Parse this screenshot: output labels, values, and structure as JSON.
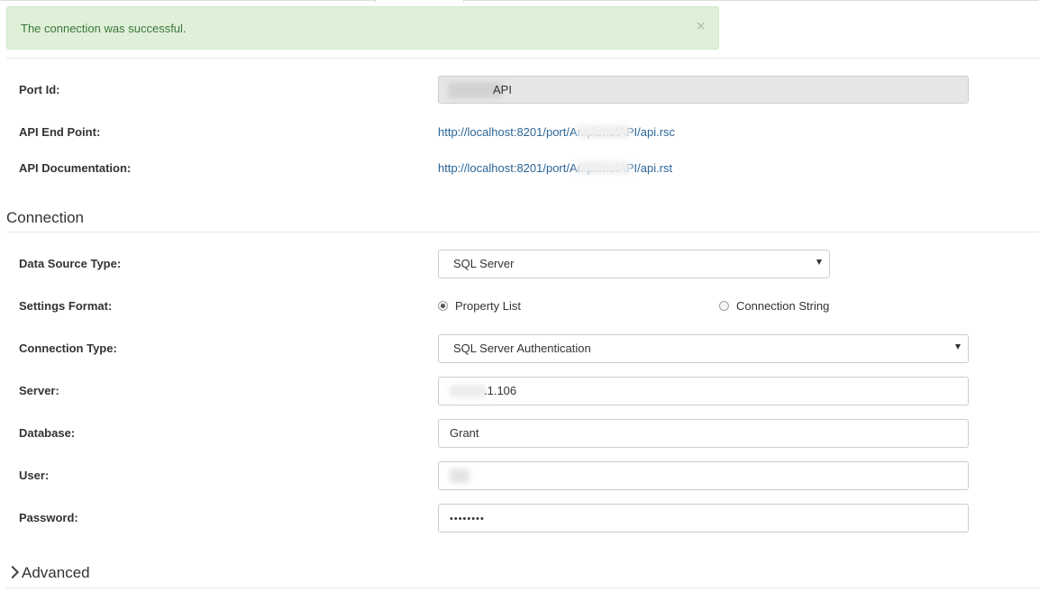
{
  "alert": {
    "message": "The connection was successful.",
    "close_glyph": "×",
    "color": "#dff0d8"
  },
  "general": {
    "port_id_label": "Port Id:",
    "port_id_value": "API",
    "api_endpoint_label": "API End Point:",
    "api_endpoint_value": "http://localhost:8201/port/AmplenolAPI/api.rsc",
    "api_doc_label": "API Documentation:",
    "api_doc_value": "http://localhost:8201/port/AmplenolAPI/api.rst"
  },
  "connection": {
    "title": "Connection",
    "data_source_type_label": "Data Source Type:",
    "data_source_type_value": "SQL Server",
    "settings_format_label": "Settings Format:",
    "settings_format_options": [
      "Property List",
      "Connection String"
    ],
    "settings_format_selected": "Property List",
    "connection_type_label": "Connection Type:",
    "connection_type_value": "SQL Server Authentication",
    "server_label": "Server:",
    "server_value": ".1.106",
    "database_label": "Database:",
    "database_value": "Grant",
    "user_label": "User:",
    "user_value": "",
    "password_label": "Password:",
    "password_value": "••••••••"
  },
  "advanced": {
    "title": "Advanced",
    "icon": "chevron-right-icon"
  },
  "colors": {
    "link": "#2a6496",
    "alert_text": "#3c763d",
    "readonly_bg": "#e6e6e6"
  }
}
